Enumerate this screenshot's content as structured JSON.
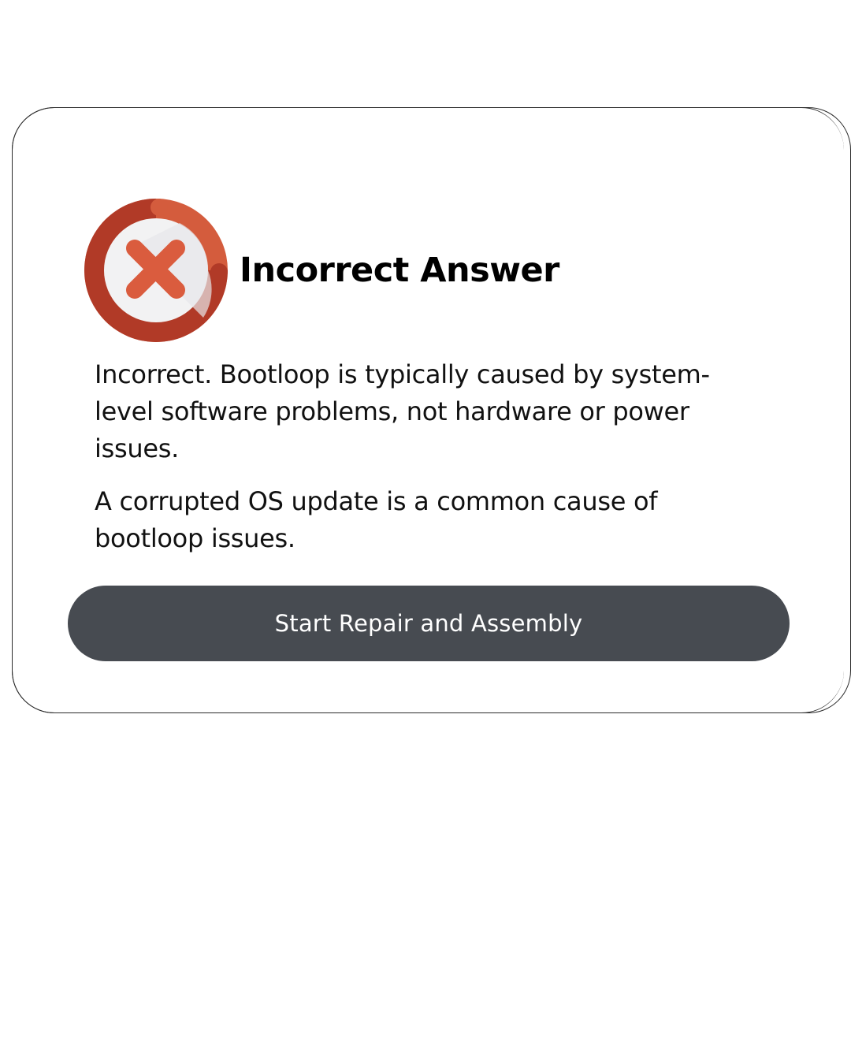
{
  "modal": {
    "icon": "error-x-icon",
    "title": "Incorrect Answer",
    "paragraphs": [
      "Incorrect. Bootloop is typically caused by system-level software problems, not hardware or power issues.",
      "A corrupted OS update is a common cause of bootloop issues."
    ],
    "primary_button_label": "Start Repair and Assembly"
  },
  "colors": {
    "icon_ring_light": "#d45c3d",
    "icon_ring_dark": "#b13a27",
    "icon_center": "#f2f2f3",
    "icon_x": "#da5c3e",
    "button_bg": "#474b51",
    "button_text": "#ffffff",
    "title_text": "#000000",
    "body_text": "#111111"
  }
}
